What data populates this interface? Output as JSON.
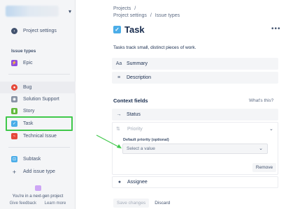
{
  "sidebar": {
    "project_settings": "Project settings",
    "issue_types_heading": "Issue types",
    "items": [
      {
        "label": "Epic",
        "icon": "epic-icon",
        "color": "#904ee2"
      },
      {
        "label": "Bug",
        "icon": "bug-icon",
        "color": "#e5493a"
      },
      {
        "label": "Solution Support",
        "icon": "support-icon",
        "color": "#8993a4"
      },
      {
        "label": "Story",
        "icon": "story-icon",
        "color": "#63ba3c"
      },
      {
        "label": "Task",
        "icon": "task-icon",
        "color": "#4bade8"
      },
      {
        "label": "Technical Issue",
        "icon": "technical-issue-icon",
        "color": "#e5493a"
      },
      {
        "label": "Subtask",
        "icon": "subtask-icon",
        "color": "#4bade8"
      }
    ],
    "add_issue_type": "Add issue type",
    "footer_text": "You're in a next-gen project",
    "give_feedback": "Give feedback",
    "learn_more": "Learn more"
  },
  "main": {
    "breadcrumb": [
      "Projects",
      "/",
      "Project settings",
      "/",
      "Issue types"
    ],
    "title": "Task",
    "description": "Tasks track small, distinct pieces of work.",
    "fields": [
      {
        "label": "Summary",
        "icon": "text-format-icon",
        "glyph": "Aa"
      },
      {
        "label": "Description",
        "icon": "paragraph-icon",
        "glyph": "≡"
      }
    ],
    "context_fields_heading": "Context fields",
    "whats_this": "What's this?",
    "status_label": "Status",
    "priority_label": "Priority",
    "default_priority_label": "Default priority (optional)",
    "select_placeholder": "Select a value",
    "remove_label": "Remove",
    "assignee_label": "Assignee",
    "save_changes": "Save changes",
    "discard": "Discard"
  },
  "colors": {
    "highlight": "#3fc84a",
    "arrow": "#3fc84a",
    "accent": "#4bade8"
  }
}
